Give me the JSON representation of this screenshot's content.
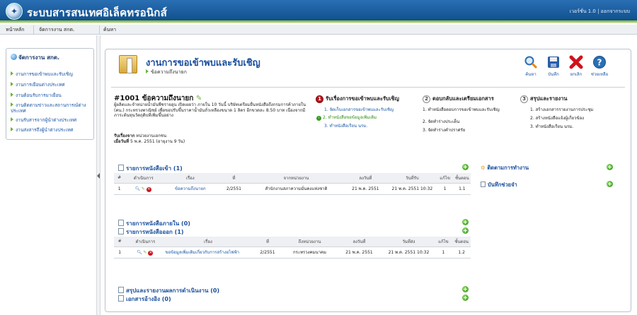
{
  "header": {
    "title": "ระบบสารสนเทศอิเล็คทรอนิกส์",
    "version": "เวอร์ชั่น 1.0 | ออกจากระบบ"
  },
  "nav": {
    "items": [
      "หน้าหลัก",
      "จัดการงาน สกต.",
      "ค้นหา"
    ]
  },
  "sidebar": {
    "title": "จัดการงาน สกต.",
    "items": [
      "งานการขอเข้าพบและรับเชิญ",
      "งานการเยือนต่างประเทศ",
      "งานต้อนรับการมาเยือน",
      "งานติดตามข่าวและสถานการณ์ต่างประเทศ",
      "งานรับสารจากผู้นำต่างประเทศ",
      "งานส่งสารถึงผู้นำต่างประเทศ"
    ]
  },
  "page": {
    "title": "งานการขอเข้าพบและรับเชิญ",
    "subtitle": "ข้อความถึงนายก"
  },
  "toolbar": {
    "search": "ค้นหา",
    "save": "บันทึก",
    "cancel": "ยกเลิก",
    "help": "ช่วยเหลือ"
  },
  "doc": {
    "number": "#1001 ข้อความถึงนายก",
    "description": "ผู้ผลิตและจำหน่ายน้ำมันพืชรายอุน เปิดเผยว่า ภายใน 10 วันนี้ บริษัทเตรียมยื่นหนังสือถึงกรมการค้าภายใน (คน.) กระทรวงพาณิชย์ เพื่อขอปรับขึ้นราคาน้ำมันถั่วเหลืองขนาด 1 ลิตร อีกขวดละ 8.50 บาท เนื่องจากมีภาระต้นทุนวัตถุดิบที่เพิ่มขึ้นอย่าง",
    "from_label": "รับเรื่องจาก",
    "from_value": "หน่วยงานเอกชน",
    "date_label": "เมื่อวันที่",
    "date_value": "5 พ.ค. 2551 (อายุงาน 9 วัน)"
  },
  "steps": [
    {
      "num": "1",
      "title": "รับเรื่องการขอเข้าพบและรับเชิญ",
      "items": [
        "1. จัดเก็บเอกสารขอเข้าพบและรับเชิญ",
        "2. ทำหนังสือขอข้อมูลเพิ่มเติม",
        "3. ทำหนังสือเรียน นรม."
      ]
    },
    {
      "num": "2",
      "title": "ตอบกลับและเตรียมเอกสาร",
      "items": [
        "1. ทำหนังสือตอบการขอเข้าพบและรับเชิญ",
        "2. จัดทำร่างประเด็น",
        "3. จัดทำร่างคำปราศรัย"
      ]
    },
    {
      "num": "3",
      "title": "สรุปและรายงาน",
      "items": [
        "1. สร้างเอกสารรายงานการประชุม",
        "2. สร้างหนังสือแจ้งผู้เกี่ยวข้อง",
        "3. ทำหนังสือเรียน นรม."
      ]
    }
  ],
  "incoming": {
    "title": "รายการหนังสือเข้า (1)",
    "headers": [
      "#",
      "ดำเนินการ",
      "เรื่อง",
      "ที่",
      "จากหน่วยงาน",
      "ลงวันที่",
      "วันที่รับ",
      "แก้ไข",
      "ชั้นตอน"
    ],
    "rows": [
      [
        "1",
        "",
        "ข้อความถึงนายก",
        "2/2551",
        "สำนักงานสภาความมั่นคงแห่งชาติ",
        "21 พ.ค. 2551",
        "21 พ.ค. 2551 10:32",
        "1",
        "1.1"
      ]
    ]
  },
  "internal": {
    "title": "รายการหนังสือภายใน (0)"
  },
  "outgoing": {
    "title": "รายการหนังสือออก (1)",
    "headers": [
      "#",
      "ดำเนินการ",
      "เรื่อง",
      "ที่",
      "ถึงหน่วยงาน",
      "ลงวันที่",
      "วันที่ส่ง",
      "แก้ไข",
      "ชั้นตอน"
    ],
    "rows": [
      [
        "1",
        "",
        "ขอข้อมูลเพิ่มเติมเกี่ยวกับการสร้างอไฟฟ้า",
        "2/2551",
        "กระทรวงคมนาคม",
        "21 พ.ค. 2551",
        "21 พ.ค. 2551 10:32",
        "1",
        "1.2"
      ]
    ]
  },
  "summary": {
    "title": "สรุปและรายงานผลการดำเนินงาน (0)"
  },
  "reference": {
    "title": "เอกสารอ้างอิง (0)"
  },
  "right_panel": {
    "tracking": "ติดตามการทำงาน",
    "memo": "บันทึกช่วยจำ"
  },
  "colors": {
    "header": "#1a5fa3",
    "accent_green": "#6fb23a",
    "link_blue": "#1a56a8",
    "active_step": "#b5121b"
  },
  "icons": [
    "logo-seal-icon",
    "folder-icon",
    "search-icon",
    "save-icon",
    "cancel-icon",
    "help-icon",
    "plus-icon",
    "edit-icon",
    "delete-icon",
    "magnify-icon",
    "document-icon"
  ]
}
